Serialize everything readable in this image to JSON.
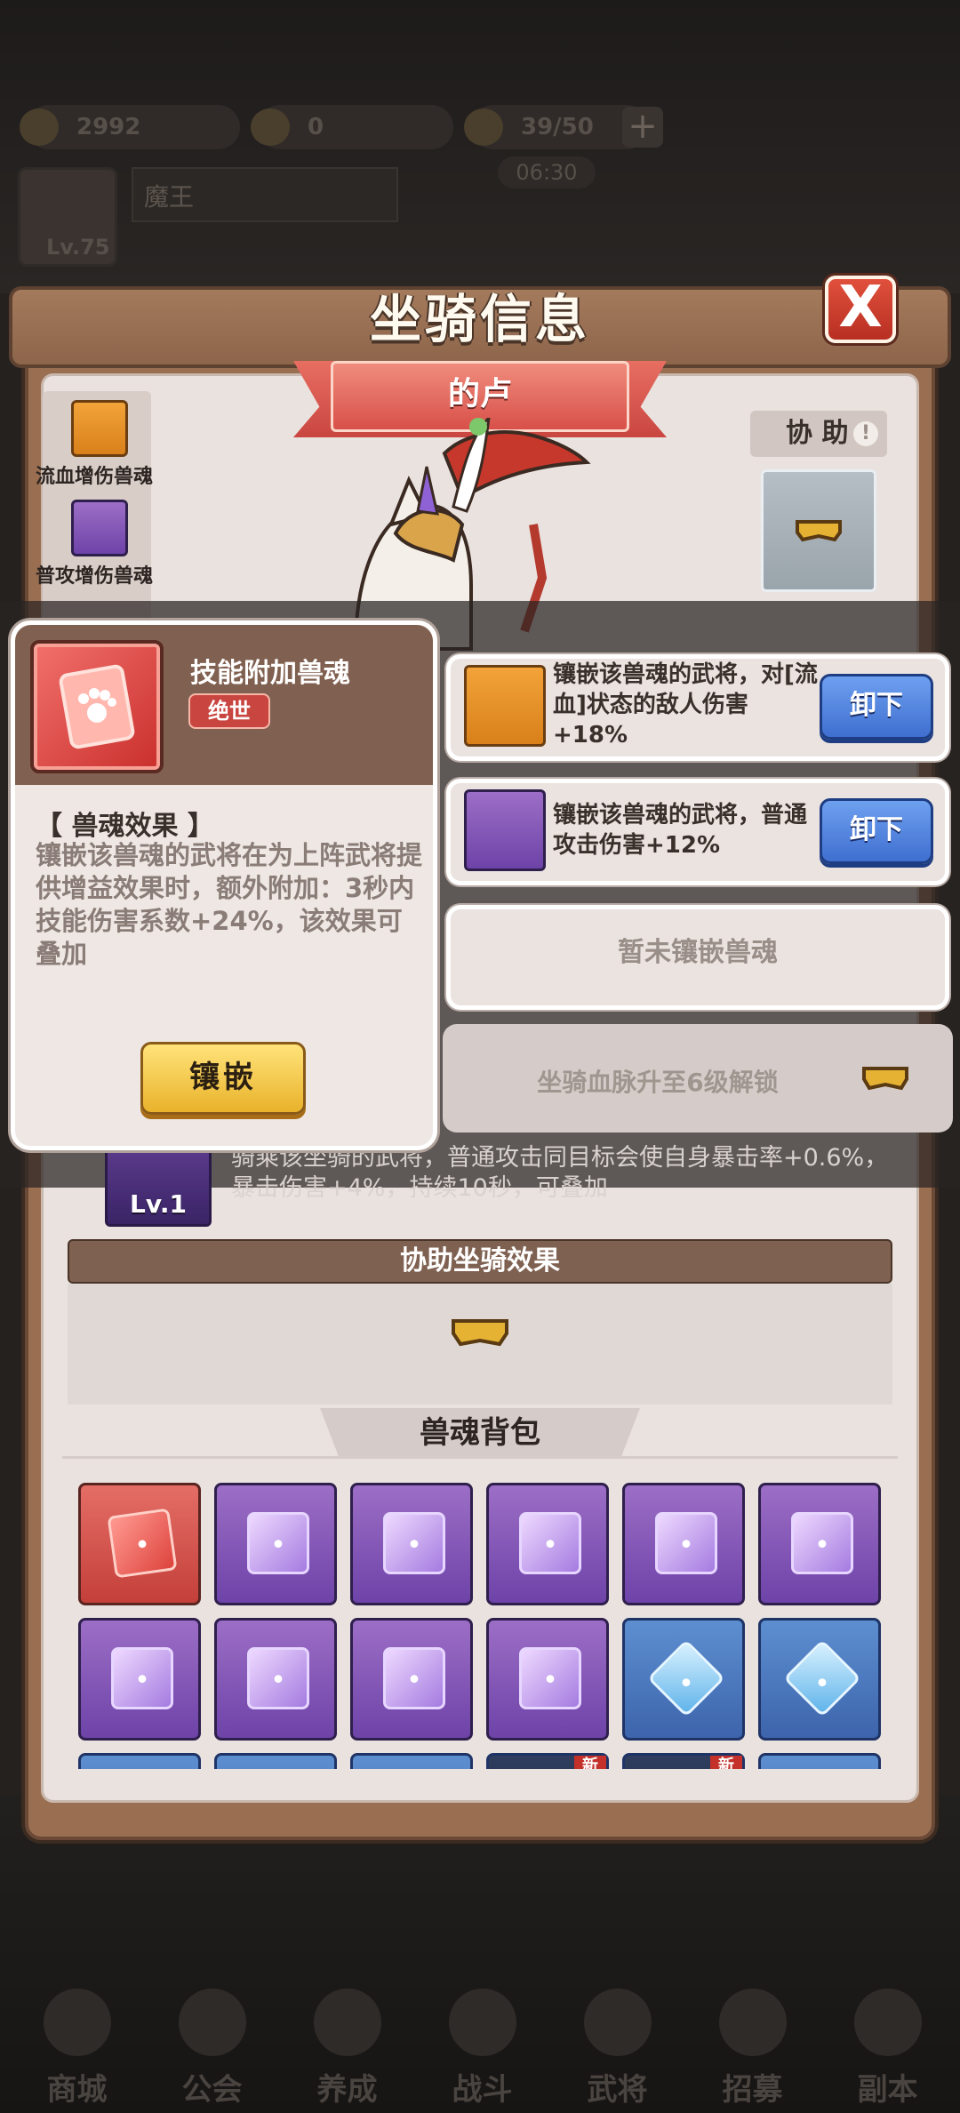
{
  "top_bar": {
    "gold": "2992",
    "gems": "0",
    "stamina": "39/50",
    "plus": "+",
    "timer": "06:30",
    "player_name": "魔王",
    "level": "Lv.75"
  },
  "dialog": {
    "title": "坐骑信息",
    "close": "X"
  },
  "mount": {
    "name": "的卢",
    "assist_label": "协 助",
    "assist_info": "!"
  },
  "equipped_souls_mini": [
    {
      "label": "流血增伤兽魂",
      "color": "#e8901f"
    },
    {
      "label": "普攻增伤兽魂",
      "color": "#7a4fb8"
    }
  ],
  "popup": {
    "name": "技能附加兽魂",
    "grade": "绝世",
    "section_title": "【 兽魂效果 】",
    "description": "镶嵌该兽魂的武将在为上阵武将提供增益效果时，额外附加：3秒内技能伤害系数+24%，该效果可叠加",
    "inlay_button": "镶嵌"
  },
  "slots": [
    {
      "description": "镶嵌该兽魂的武将，对[流血]状态的敌人伤害+18%",
      "button": "卸下",
      "color": "#e8901f"
    },
    {
      "description": "镶嵌该兽魂的武将，普通攻击伤害+12%",
      "button": "卸下",
      "color": "#7a4fb8"
    }
  ],
  "slot_empty": "暂未镶嵌兽魂",
  "slot_locked": "坐骑血脉升至6级解锁",
  "behind": {
    "effect_text": "骑乘该坐骑的武将，普通攻击同目标会使自身暴击率+0.6%，暴击伤害+4%，持续10秒，可叠加",
    "level": "Lv.1"
  },
  "assist_section": {
    "title": "协助坐骑效果"
  },
  "bag": {
    "title": "兽魂背包",
    "items": [
      {
        "type": "red"
      },
      {
        "type": "purple"
      },
      {
        "type": "purple"
      },
      {
        "type": "purple"
      },
      {
        "type": "purple"
      },
      {
        "type": "purple"
      },
      {
        "type": "purple"
      },
      {
        "type": "purple"
      },
      {
        "type": "purple"
      },
      {
        "type": "purple"
      },
      {
        "type": "blue"
      },
      {
        "type": "blue"
      },
      {
        "type": "blue"
      },
      {
        "type": "blue"
      },
      {
        "type": "blue"
      },
      {
        "type": "dark",
        "new": "新"
      },
      {
        "type": "dark",
        "new": "新"
      },
      {
        "type": "blue"
      }
    ]
  },
  "bottom_nav": [
    "商城",
    "公会",
    "养成",
    "战斗",
    "武将",
    "招募",
    "副本"
  ]
}
